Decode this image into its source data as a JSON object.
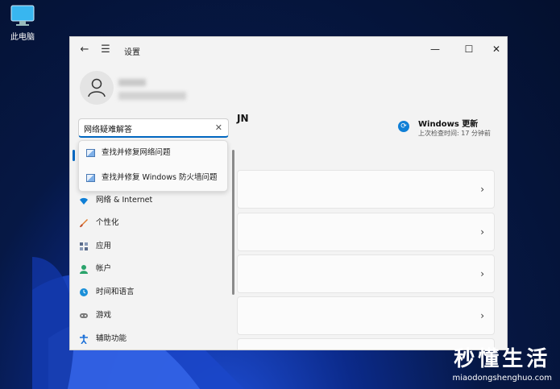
{
  "desktop": {
    "icon_label": "此电脑"
  },
  "watermark": {
    "title": "秒懂生活",
    "subtitle": "miaodongshenghuo.com"
  },
  "window": {
    "title": "设置",
    "controls": {
      "minimize": "—",
      "maximize": "☐",
      "close": "✕"
    }
  },
  "search": {
    "value": "网络疑难解答",
    "clear": "✕"
  },
  "suggestions": [
    {
      "label": "查找并修复网络问题"
    },
    {
      "label": "查找并修复 Windows 防火墙问题"
    }
  ],
  "nav": {
    "items": [
      {
        "label": "网络 & Internet",
        "icon": "wifi-icon",
        "color": "#0f7fd6"
      },
      {
        "label": "个性化",
        "icon": "brush-icon",
        "color": "#e07a2b"
      },
      {
        "label": "应用",
        "icon": "apps-icon",
        "color": "#5a6b8a"
      },
      {
        "label": "帐户",
        "icon": "person-icon",
        "color": "#2aa36b"
      },
      {
        "label": "时间和语言",
        "icon": "globe-clock-icon",
        "color": "#1a8fd8"
      },
      {
        "label": "游戏",
        "icon": "gamepad-icon",
        "color": "#7a7a7a"
      },
      {
        "label": "辅助功能",
        "icon": "accessibility-icon",
        "color": "#1a6fd8"
      }
    ]
  },
  "right_pane": {
    "pc_name": "JN",
    "update": {
      "title": "Windows 更新",
      "subtitle": "上次检查时间: 17 分钟前"
    },
    "cards": [
      {},
      {},
      {},
      {},
      {}
    ]
  },
  "colors": {
    "accent": "#0067c0"
  }
}
